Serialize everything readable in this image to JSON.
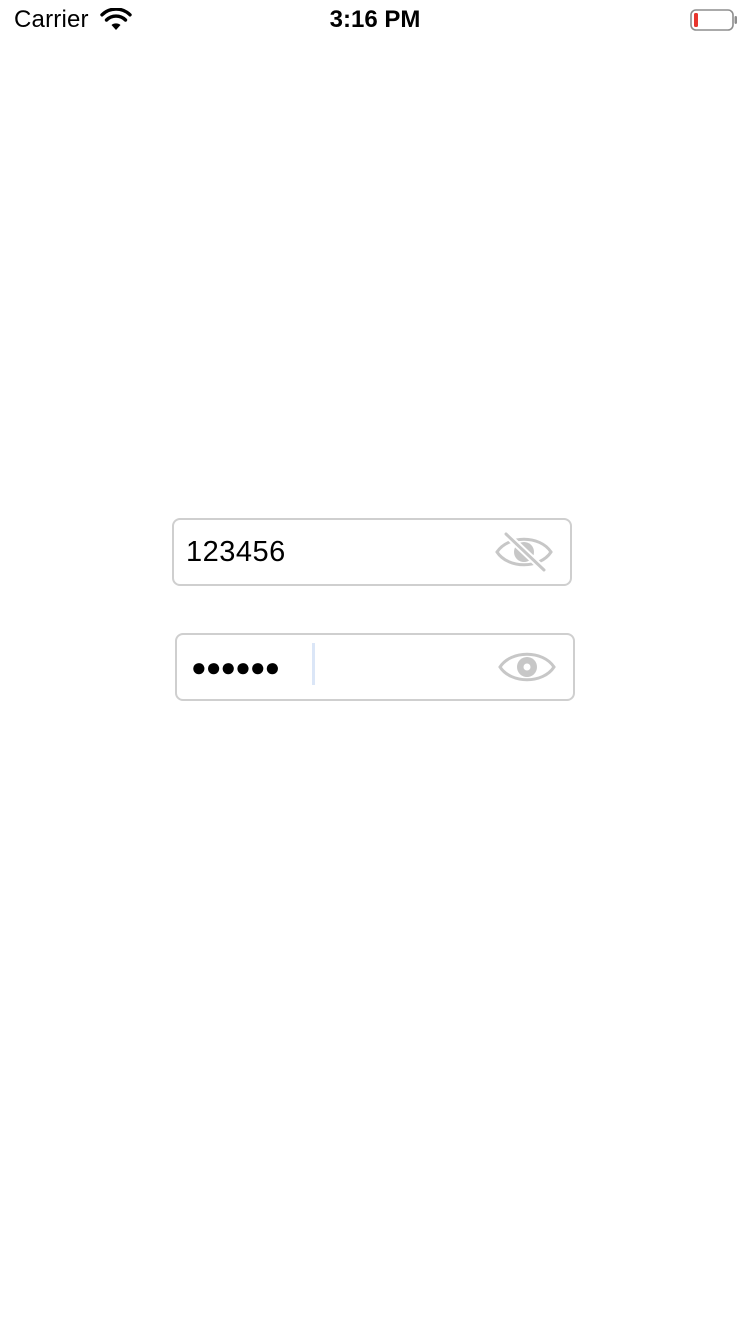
{
  "status_bar": {
    "carrier": "Carrier",
    "time": "3:16 PM",
    "battery_level_color": "#e8362e"
  },
  "form": {
    "field1": {
      "value": "123456",
      "toggle_icon": "eye-slash-icon"
    },
    "field2": {
      "value": "●●●●●●",
      "toggle_icon": "eye-icon"
    }
  },
  "colors": {
    "border": "#cfcfcf",
    "icon": "#c7c7c7",
    "background": "#ffffff"
  }
}
